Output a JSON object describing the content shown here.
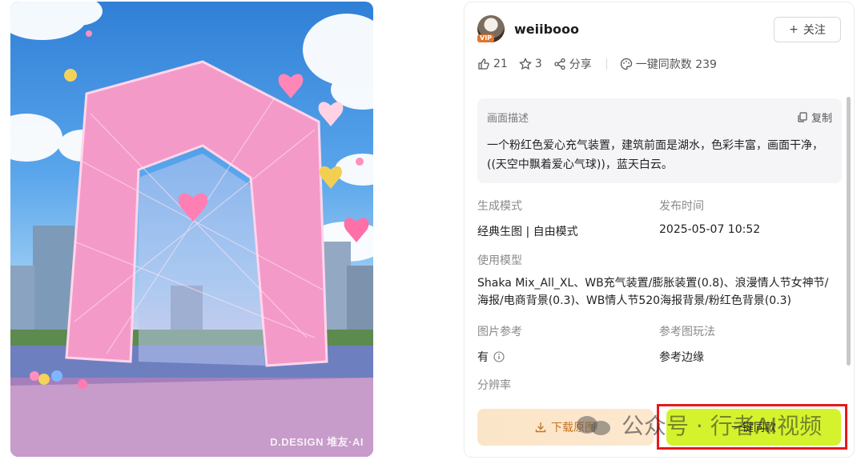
{
  "artwork": {
    "watermark": "D.DESIGN 堆友·AI",
    "icon": "inflatable-heart-arch-image"
  },
  "author": {
    "name": "weiibooo",
    "badge": "VIP",
    "follow_label": "关注",
    "follow_icon": "plus-icon"
  },
  "stats": {
    "likes": "21",
    "favorites": "3",
    "share_label": "分享",
    "same_style_label": "一键同款数 239"
  },
  "description": {
    "title": "画面描述",
    "copy_label": "复制",
    "text": "一个粉红色爱心充气装置，建筑前面是湖水，色彩丰富，画面干净，((天空中飘着爱心气球))，蓝天白云。"
  },
  "fields": {
    "mode_label": "生成模式",
    "mode_value": "经典生图 | 自由模式",
    "time_label": "发布时间",
    "time_value": "2025-05-07 10:52",
    "model_label": "使用模型",
    "model_value": "Shaka Mix_All_XL、WB充气装置/膨胀装置(0.8)、浪漫情人节女神节/海报/电商背景(0.3)、WB情人节520海报背景/粉红色背景(0.3)",
    "ref_label": "图片参考",
    "ref_value": "有",
    "ref_play_label": "参考图玩法",
    "ref_play_value": "参考边缘",
    "resolution_label": "分辨率"
  },
  "actions": {
    "download_label": "下载原图",
    "same_label": "一键同款"
  },
  "overlay_watermark": "公众号 · 行者AI视频",
  "colors": {
    "accent_green": "#d4f32d",
    "download_text": "#c4751f",
    "highlight_red": "#e81919"
  }
}
